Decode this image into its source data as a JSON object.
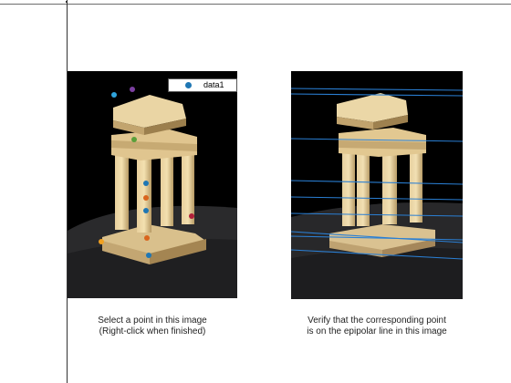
{
  "left_figure": {
    "legend_label": "data1",
    "caption_line1": "Select a point in this image",
    "caption_line2": "(Right-click when finished)"
  },
  "right_figure": {
    "caption_line1": "Verify that the corresponding point",
    "caption_line2": "is on the epipolar line in this image"
  },
  "colors": {
    "marker_colors": [
      "#2fa3dc",
      "#7b3fa0",
      "#5a9f3a",
      "#1f77b4",
      "#d9651e",
      "#1f77b4",
      "#b0203a",
      "#d9651e",
      "#f0a020",
      "#1f77b4"
    ],
    "epipolar_line": "#2a7fd4",
    "legend_marker": "#1f77b4"
  }
}
